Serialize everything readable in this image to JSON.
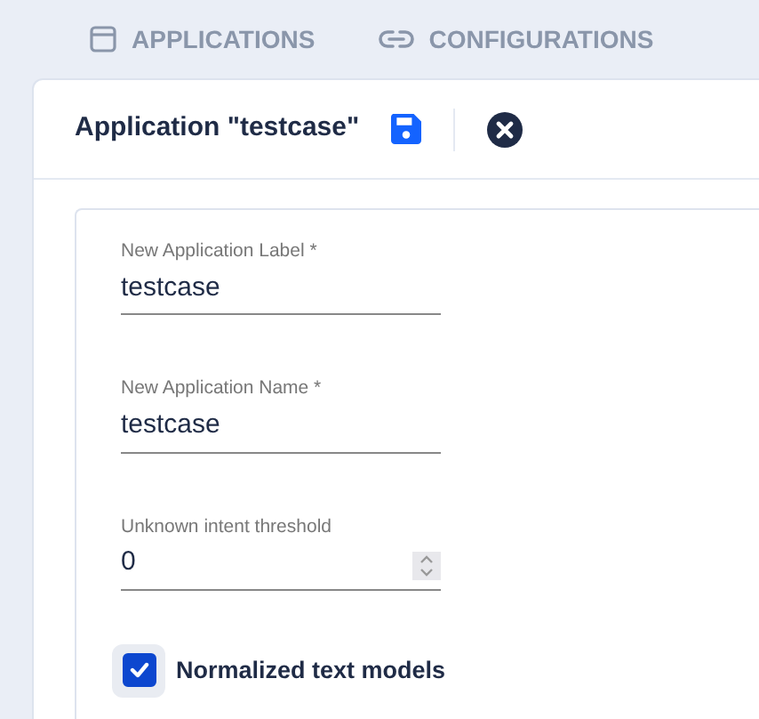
{
  "tabs": [
    {
      "label": "APPLICATIONS",
      "selected": false
    },
    {
      "label": "CONFIGURATIONS",
      "selected": false
    }
  ],
  "card": {
    "title": "Application \"testcase\""
  },
  "fields": [
    {
      "kind": "text",
      "label": "New Application Label *",
      "value": "testcase"
    },
    {
      "kind": "text",
      "label": "New Application Name *",
      "value": "testcase"
    },
    {
      "kind": "number",
      "label": "Unknown intent threshold",
      "value": "0"
    }
  ],
  "checkbox": {
    "label": "Normalized text models",
    "checked": true
  }
}
